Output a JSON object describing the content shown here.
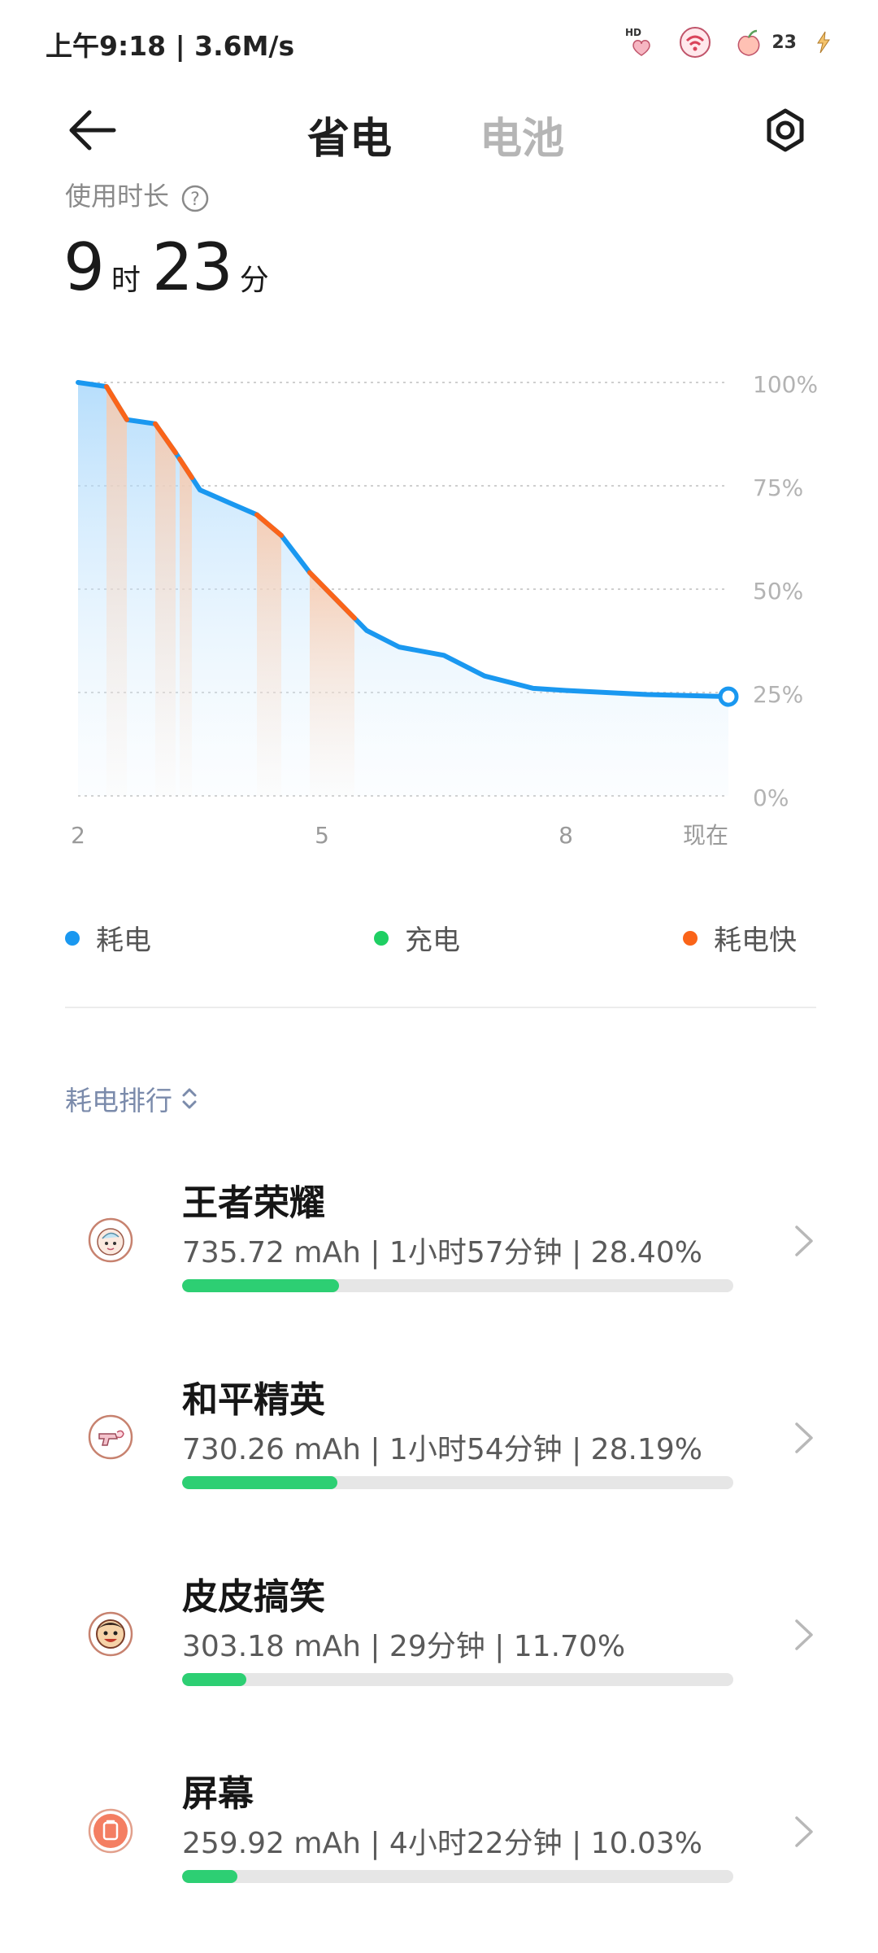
{
  "status_bar": {
    "time_speed": "上午9:18 | 3.6M/s",
    "icons": [
      "hd-heart-icon",
      "wifi-sticker-icon",
      "peach-battery-icon",
      "lightning-icon"
    ],
    "battery_level": "23"
  },
  "header": {
    "back_icon": "arrow-left-icon",
    "tabs": [
      {
        "label": "省电",
        "active": true
      },
      {
        "label": "电池",
        "active": false
      }
    ],
    "settings_icon": "gear-icon"
  },
  "usage": {
    "label": "使用时长",
    "hours": "9",
    "hours_unit": "时",
    "minutes": "23",
    "minutes_unit": "分"
  },
  "chart_data": {
    "type": "line",
    "x_tick_labels": [
      "2",
      "5",
      "8",
      "现在"
    ],
    "x_ticks": [
      2,
      5,
      8,
      10
    ],
    "y_tick_labels": [
      "100%",
      "75%",
      "50%",
      "25%",
      "0%"
    ],
    "y_ticks": [
      100,
      75,
      50,
      25,
      0
    ],
    "xlim": [
      2,
      10
    ],
    "ylim": [
      0,
      100
    ],
    "grid": true,
    "series": [
      {
        "name": "耗电",
        "color": "#1a98f0",
        "x": [
          2.0,
          2.35,
          2.6,
          2.95,
          3.2,
          3.5,
          3.85,
          4.2,
          4.5,
          4.85,
          5.2,
          5.55,
          5.95,
          6.5,
          7.0,
          7.6,
          8.0,
          9.0,
          10.0
        ],
        "y": [
          100,
          99,
          91,
          90,
          83,
          74,
          71,
          68,
          63,
          54,
          47,
          40,
          36,
          34,
          29,
          26,
          25.5,
          24.5,
          24
        ]
      }
    ],
    "fast_drain_color": "#fa6419",
    "fast_drain_segments": [
      [
        2.35,
        2.6
      ],
      [
        2.95,
        3.2
      ],
      [
        3.25,
        3.4
      ],
      [
        4.2,
        4.5
      ],
      [
        4.85,
        5.4
      ]
    ],
    "current_value": 24
  },
  "legend": [
    {
      "label": "耗电",
      "color": "#1a98f0"
    },
    {
      "label": "充电",
      "color": "#1fcf63"
    },
    {
      "label": "耗电快",
      "color": "#fa6419"
    }
  ],
  "ranking": {
    "title": "耗电排行",
    "sort_icon": "sort-updown-icon",
    "items": [
      {
        "name": "王者荣耀",
        "detail": "735.72 mAh | 1小时57分钟 | 28.40%",
        "percent": 28.4,
        "icon": "honor-of-kings-icon"
      },
      {
        "name": "和平精英",
        "detail": "730.26 mAh | 1小时54分钟 | 28.19%",
        "percent": 28.19,
        "icon": "peacekeeper-elite-icon"
      },
      {
        "name": "皮皮搞笑",
        "detail": "303.18 mAh | 29分钟 | 11.70%",
        "percent": 11.7,
        "icon": "pipi-funny-icon"
      },
      {
        "name": "屏幕",
        "detail": "259.92 mAh | 4小时22分钟 | 10.03%",
        "percent": 10.03,
        "icon": "screen-icon"
      }
    ]
  }
}
